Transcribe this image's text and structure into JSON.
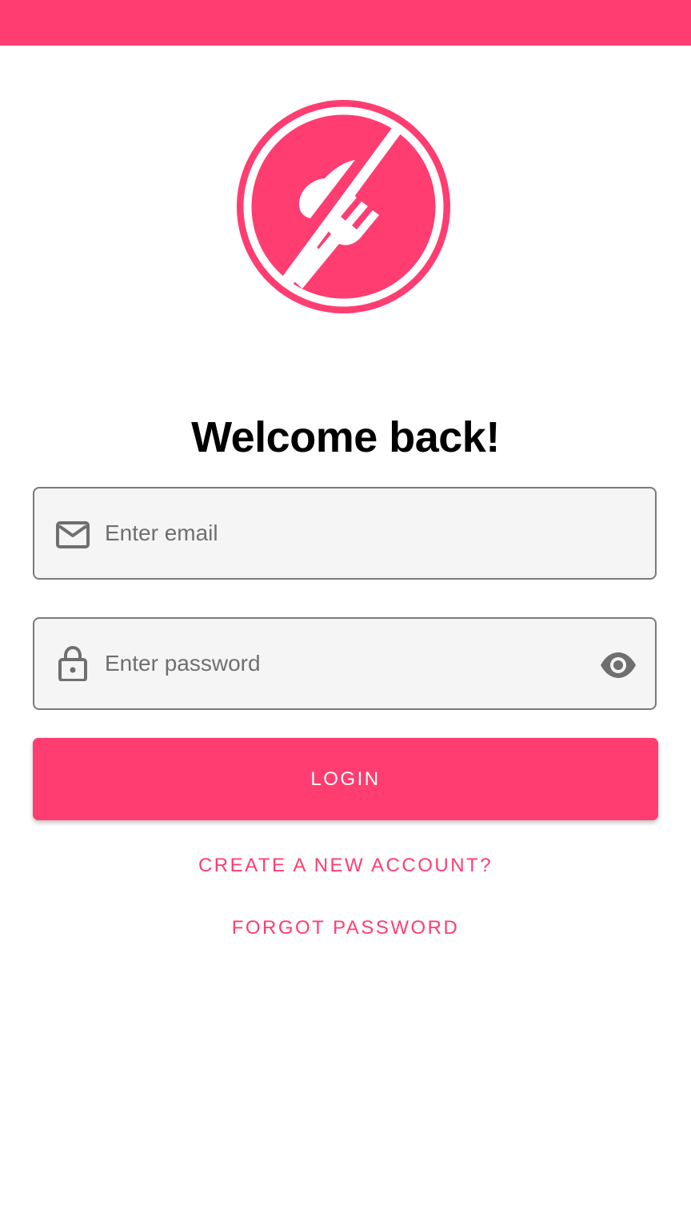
{
  "colors": {
    "accent": "#ff3d71",
    "field_background": "#f5f5f5",
    "field_border": "#7a7a7a",
    "icon_gray": "#6f6f6f"
  },
  "logo": {
    "icon": "fork-and-spoon-slash-icon"
  },
  "login": {
    "title": "Welcome back!",
    "email": {
      "placeholder": "Enter email",
      "value": "",
      "icon": "mail-icon"
    },
    "password": {
      "placeholder": "Enter password",
      "value": "",
      "icon": "lock-icon",
      "toggle_icon": "eye-icon"
    },
    "login_label": "LOGIN",
    "create_account_label": "CREATE A NEW ACCOUNT?",
    "forgot_password_label": "FORGOT PASSWORD"
  }
}
